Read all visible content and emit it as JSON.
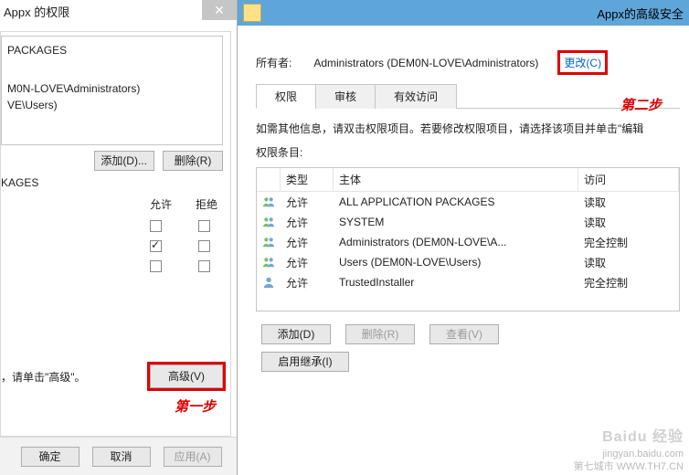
{
  "left": {
    "title": "Appx 的权限",
    "list_items": [
      "PACKAGES",
      "M0N-LOVE\\Administrators)",
      "VE\\Users)"
    ],
    "snippet_label": "KAGES",
    "btn_add": "添加(D)...",
    "btn_remove": "删除(R)",
    "col_allow": "允许",
    "col_deny": "拒绝",
    "checkgrid": [
      {
        "allow": false,
        "deny": false
      },
      {
        "allow": true,
        "deny": false
      },
      {
        "allow": false,
        "deny": false
      }
    ],
    "adv_hint": "，请单击\"高级\"。",
    "btn_advanced": "高级(V)",
    "step1": "第一步",
    "btn_ok": "确定",
    "btn_cancel": "取消",
    "btn_apply": "应用(A)"
  },
  "right": {
    "title": "Appx的高级安全",
    "owner_label": "所有者:",
    "owner_value": "Administrators (DEM0N-LOVE\\Administrators)",
    "change_link": "更改(C)",
    "step2": "第二步",
    "tabs": [
      "权限",
      "审核",
      "有效访问"
    ],
    "active_tab": 0,
    "instr1": "如需其他信息，请双击权限项目。若要修改权限项目，请选择该项目并单击\"编辑",
    "instr2": "权限条目:",
    "headers": {
      "type": "类型",
      "principal": "主体",
      "access": "访问"
    },
    "entries": [
      {
        "type": "允许",
        "principal": "ALL APPLICATION PACKAGES",
        "access": "读取",
        "icon": "group"
      },
      {
        "type": "允许",
        "principal": "SYSTEM",
        "access": "读取",
        "icon": "group"
      },
      {
        "type": "允许",
        "principal": "Administrators (DEM0N-LOVE\\A...",
        "access": "完全控制",
        "icon": "group"
      },
      {
        "type": "允许",
        "principal": "Users (DEM0N-LOVE\\Users)",
        "access": "读取",
        "icon": "group"
      },
      {
        "type": "允许",
        "principal": "TrustedInstaller",
        "access": "完全控制",
        "icon": "user"
      }
    ],
    "btn_add": "添加(D)",
    "btn_remove": "删除(R)",
    "btn_view": "查看(V)",
    "btn_inherit": "启用继承(I)"
  },
  "watermark": {
    "brand": "Baidu 经验",
    "url": "jingyan.baidu.com",
    "src": "第七城市  WWW.TH7.CN"
  }
}
